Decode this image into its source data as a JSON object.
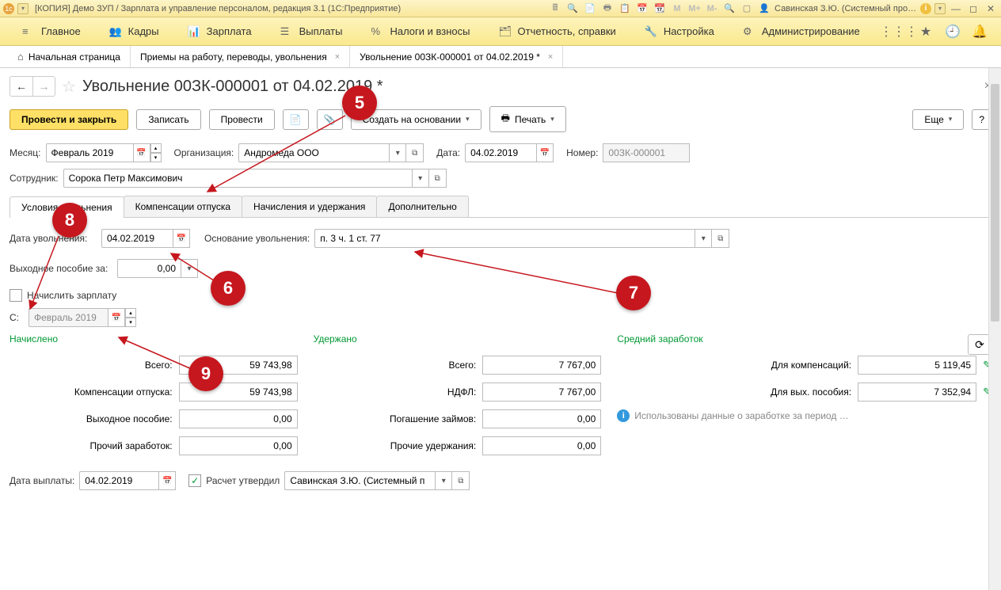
{
  "titlebar": {
    "title": "[КОПИЯ] Демо ЗУП / Зарплата и управление персоналом, редакция 3.1  (1С:Предприятие)",
    "user": "Савинская З.Ю. (Системный прог…",
    "m_icons": [
      "M",
      "M+",
      "M-"
    ]
  },
  "mainnav": {
    "items": [
      {
        "icon": "≡",
        "label": "Главное"
      },
      {
        "icon": "👥",
        "label": "Кадры"
      },
      {
        "icon": "📊",
        "label": "Зарплата"
      },
      {
        "icon": "💰",
        "label": "Выплаты"
      },
      {
        "icon": "%",
        "label": "Налоги и взносы"
      },
      {
        "icon": "📄",
        "label": "Отчетность, справки"
      },
      {
        "icon": "🔧",
        "label": "Настройка"
      },
      {
        "icon": "⚙",
        "label": "Администрирование"
      }
    ]
  },
  "tabs": {
    "home": "Начальная страница",
    "t1": "Приемы на работу, переводы, увольнения",
    "t2": "Увольнение 00ЗК-000001 от 04.02.2019 *"
  },
  "page": {
    "title": "Увольнение 00ЗК-000001 от 04.02.2019 *"
  },
  "cmdbar": {
    "post_close": "Провести и закрыть",
    "save": "Записать",
    "post": "Провести",
    "create_based": "Создать на основании",
    "print": "Печать",
    "more": "Еще"
  },
  "header_fields": {
    "month_label": "Месяц:",
    "month_value": "Февраль 2019",
    "org_label": "Организация:",
    "org_value": "Андромеда ООО",
    "date_label": "Дата:",
    "date_value": "04.02.2019",
    "num_label": "Номер:",
    "num_value": "00ЗК-000001",
    "emp_label": "Сотрудник:",
    "emp_value": "Сорока Петр Максимович"
  },
  "subtabs": {
    "t1": "Условия увольнения",
    "t2": "Компенсации отпуска",
    "t3": "Начисления и удержания",
    "t4": "Дополнительно"
  },
  "dismissal": {
    "date_label": "Дата увольнения:",
    "date_value": "04.02.2019",
    "reason_label": "Основание увольнения:",
    "reason_value": "п. 3 ч. 1 ст. 77",
    "severance_label": "Выходное пособие за:",
    "severance_value": "0,00",
    "accrue_label": "Начислить зарплату",
    "from_label": "С:",
    "from_value": "Февраль 2019"
  },
  "totals": {
    "accrued_head": "Начислено",
    "withheld_head": "Удержано",
    "avg_head": "Средний заработок",
    "accrued": {
      "total_l": "Всего:",
      "total_v": "59 743,98",
      "comp_l": "Компенсации отпуска:",
      "comp_v": "59 743,98",
      "sev_l": "Выходное пособие:",
      "sev_v": "0,00",
      "other_l": "Прочий заработок:",
      "other_v": "0,00"
    },
    "withheld": {
      "total_l": "Всего:",
      "total_v": "7 767,00",
      "ndfl_l": "НДФЛ:",
      "ndfl_v": "7 767,00",
      "loan_l": "Погашение займов:",
      "loan_v": "0,00",
      "other_l": "Прочие удержания:",
      "other_v": "0,00"
    },
    "avg": {
      "comp_l": "Для компенсаций:",
      "comp_v": "5 119,45",
      "sev_l": "Для вых. пособия:",
      "sev_v": "7 352,94",
      "info": "Использованы данные о заработке за период …"
    }
  },
  "footer": {
    "paydate_label": "Дата выплаты:",
    "paydate_value": "04.02.2019",
    "approved_label": "Расчет утвердил",
    "approved_value": "Савинская З.Ю. (Системный п"
  },
  "markers": {
    "m5": "5",
    "m6": "6",
    "m7": "7",
    "m8": "8",
    "m9": "9"
  }
}
